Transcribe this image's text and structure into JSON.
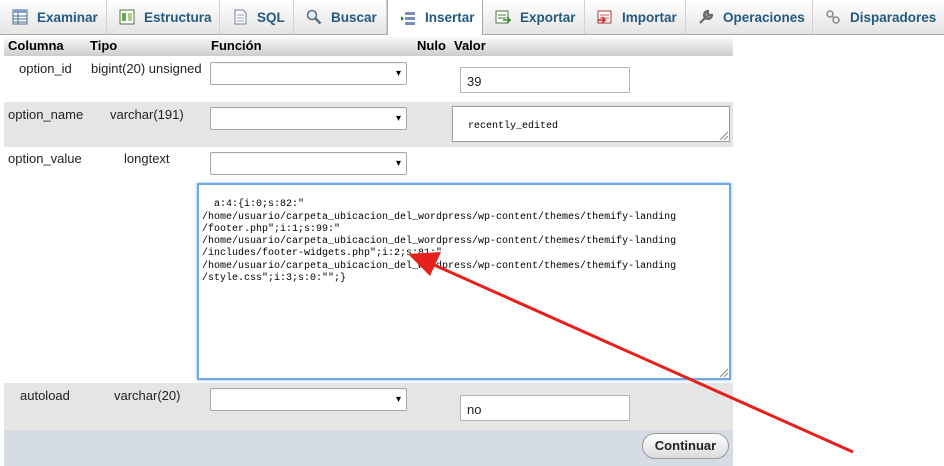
{
  "tabs": [
    {
      "label": "Examinar",
      "icon": "table-browse-icon"
    },
    {
      "label": "Estructura",
      "icon": "structure-icon"
    },
    {
      "label": "SQL",
      "icon": "sql-document-icon"
    },
    {
      "label": "Buscar",
      "icon": "search-icon"
    },
    {
      "label": "Insertar",
      "icon": "insert-row-icon",
      "active": true
    },
    {
      "label": "Exportar",
      "icon": "export-icon"
    },
    {
      "label": "Importar",
      "icon": "import-icon"
    },
    {
      "label": "Operaciones",
      "icon": "wrench-icon"
    },
    {
      "label": "Disparadores",
      "icon": "triggers-icon"
    }
  ],
  "headers": {
    "columna": "Columna",
    "tipo": "Tipo",
    "funcion": "Función",
    "nulo": "Nulo",
    "valor": "Valor"
  },
  "rows": [
    {
      "column": "option_id",
      "type": "bigint(20) unsigned",
      "function": "",
      "value": "39"
    },
    {
      "column": "option_name",
      "type": "varchar(191)",
      "function": "",
      "value": "recently_edited"
    },
    {
      "column": "option_value",
      "type": "longtext",
      "function": "",
      "value": "a:4:{i:0;s:82:\"\n/home/usuario/carpeta_ubicacion_del_wordpress/wp-content/themes/themify-landing\n/footer.php\";i:1;s:99:\"\n/home/usuario/carpeta_ubicacion_del_wordpress/wp-content/themes/themify-landing\n/includes/footer-widgets.php\";i:2;s:81:\"\n/home/usuario/carpeta_ubicacion_del_wordpress/wp-content/themes/themify-landing\n/style.css\";i:3;s:0:\"\";}"
    },
    {
      "column": "autoload",
      "type": "varchar(20)",
      "function": "",
      "value": "no"
    }
  ],
  "submit_label": "Continuar",
  "colors": {
    "tab_text": "#235a81",
    "arrow": "#e8201c",
    "focus": "#6fa7e7"
  }
}
